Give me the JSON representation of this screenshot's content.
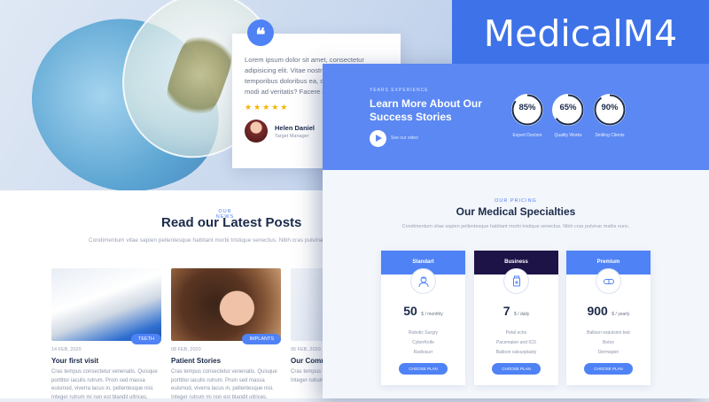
{
  "brand": {
    "title": "MedicalM4"
  },
  "testimonial": {
    "text": "Lorem ipsum dolor sit amet, consectetur adipisicing elit. Vitae nostrum fugiat blanditiis, temporibus doloribus ea, officiis consectetur, modi ad veritatis? Facere accusantium sunt",
    "stars": "★★★★★",
    "author_name": "Helen Daniel",
    "author_role": "Target Manager"
  },
  "news": {
    "eyebrow": "OUR NEWS",
    "title": "Read our Latest Posts",
    "lead": "Condimentum vitae sapien pellentesque habitant morbi tristique senectus. Nibh cras pulvinar",
    "posts": [
      {
        "tag": "TEETH",
        "date": "14 FEB, 2020",
        "title": "Your first visit",
        "excerpt": "Cras tempus consectetur venenatis. Quisque porttitor iaculis rutrum. Proin sed massa euismod, viverra lacus in, pellentesque nisi. Integer rutrum mi non est blandit ultrices."
      },
      {
        "tag": "IMPLANTS",
        "date": "08 FEB, 2020",
        "title": "Patient Stories",
        "excerpt": "Cras tempus consectetur venenatis. Quisque porttitor iaculis rutrum. Proin sed massa euismod, viverra lacus in, pellentesque nisi. Integer rutrum mi non est blandit ultrices."
      },
      {
        "tag": "",
        "date": "05 FEB, 2020",
        "title": "Our Comm",
        "excerpt": "Cras tempus c porttitor iaculi euismod, viver Integer rutrum r"
      }
    ]
  },
  "stats": {
    "eyebrow": "YEARS EXPERIENCE",
    "title": "Learn More About Our Success Stories",
    "video_label": "See our video",
    "rings": [
      {
        "value": "85%",
        "label": "Expert Doctors",
        "percent": 85
      },
      {
        "value": "65%",
        "label": "Quality Works",
        "percent": 65
      },
      {
        "value": "90%",
        "label": "Smiling Clients",
        "percent": 90
      }
    ]
  },
  "pricing": {
    "eyebrow": "OUR PRICING",
    "title": "Our Medical Specialties",
    "lead": "Condimentum vitae sapien pellentesque habitant morbi tristique senectus. Nibh cras pulvinar mattis nunc.",
    "plans": [
      {
        "name": "Standart",
        "price": "50",
        "unit": "$ / monthly",
        "features": [
          "Robotic Surgry",
          "CyberKnife",
          "Radiosurr"
        ],
        "button": "CHOOSE PLAN",
        "icon": "nurse-icon"
      },
      {
        "name": "Business",
        "price": "7",
        "unit": "$ / daily",
        "features": [
          "Petal echo",
          "Pacemaker and ICD",
          "Balloon valvuoplasty"
        ],
        "button": "CHOOSE PLAN",
        "icon": "medicine-jar-icon"
      },
      {
        "name": "Premium",
        "price": "900",
        "unit": "$ / yearly",
        "features": [
          "Balloon expulsion test",
          "Botox",
          "Dermapen"
        ],
        "button": "CHOOSE PLAN",
        "icon": "pill-icon"
      }
    ]
  },
  "colors": {
    "accent": "#4f82f5",
    "stats_bg": "#5b88f2",
    "dark_header": "#1d1347",
    "brand_bg": "#3e72e8",
    "star": "#f5b400"
  }
}
